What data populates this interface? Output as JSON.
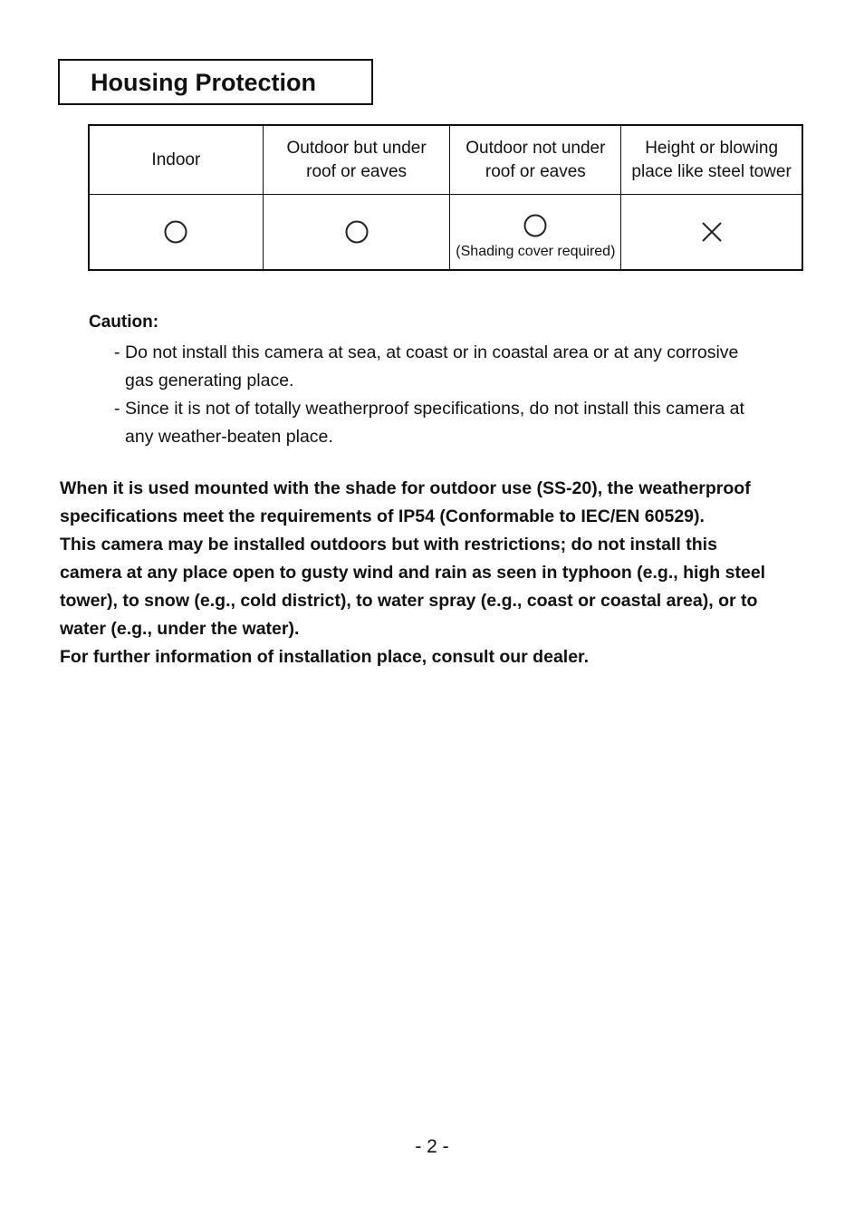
{
  "section_title": "Housing Protection",
  "protection_table": {
    "columns": [
      {
        "label_line1": "Indoor",
        "label_line2": "",
        "mark": "circle-icon",
        "allowed": true,
        "note": ""
      },
      {
        "label_line1": "Outdoor but under",
        "label_line2": "roof or eaves",
        "mark": "circle-icon",
        "allowed": true,
        "note": ""
      },
      {
        "label_line1": "Outdoor not under",
        "label_line2": "roof or eaves",
        "mark": "circle-icon",
        "allowed": true,
        "note": "(Shading cover required)"
      },
      {
        "label_line1": "Height or blowing",
        "label_line2": "place like steel tower",
        "mark": "cross-icon",
        "allowed": false,
        "note": ""
      }
    ]
  },
  "caution": {
    "label": "Caution:",
    "items": [
      {
        "dash": "-",
        "line1": "Do not install this camera at sea, at coast or in coastal area or at any corrosive",
        "line2": "gas generating place."
      },
      {
        "dash": "-",
        "line1": "Since it is not of totally weatherproof specifications, do not install this camera at",
        "line2": "any weather-beaten place."
      }
    ]
  },
  "body_lines": [
    "When it is used mounted with the shade for outdoor use (SS-20), the weatherproof",
    "specifications meet the requirements of IP54 (Conformable to IEC/EN 60529).",
    "This camera may be installed outdoors but with restrictions; do not install this",
    "camera at any place open to gusty wind and rain as seen in typhoon (e.g., high steel",
    "tower), to snow (e.g., cold district), to water spray (e.g., coast or coastal area), or to",
    "water (e.g., under the water).",
    "For further information of installation place, consult our dealer."
  ],
  "page_number": "- 2 -"
}
